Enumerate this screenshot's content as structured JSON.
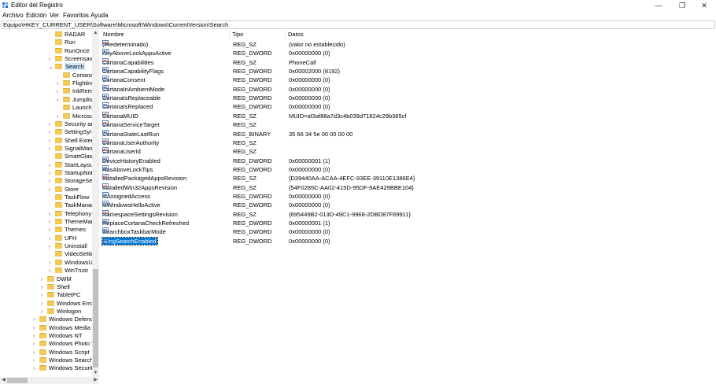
{
  "window": {
    "title": "Editor del Registro",
    "minimize": "—",
    "maximize": "❐",
    "close": "✕"
  },
  "menu": [
    "Archivo",
    "Edición",
    "Ver",
    "Favoritos",
    "Ayuda"
  ],
  "address": "Equipo\\HKEY_CURRENT_USER\\Software\\Microsoft\\Windows\\CurrentVersion\\Search",
  "tree": [
    {
      "label": "RADAR",
      "depth": 2,
      "expander": "none"
    },
    {
      "label": "Run",
      "depth": 2,
      "expander": "none"
    },
    {
      "label": "RunOnce",
      "depth": 2,
      "expander": "none"
    },
    {
      "label": "Screensaver",
      "depth": 2,
      "expander": "collapsed"
    },
    {
      "label": "Search",
      "depth": 2,
      "expander": "expanded",
      "selected": true
    },
    {
      "label": "CortanaA",
      "depth": 3,
      "expander": "none"
    },
    {
      "label": "Flighting",
      "depth": 3,
      "expander": "collapsed"
    },
    {
      "label": "InkRemin",
      "depth": 3,
      "expander": "collapsed"
    },
    {
      "label": "JumplistI",
      "depth": 3,
      "expander": "collapsed"
    },
    {
      "label": "Launch",
      "depth": 3,
      "expander": "none"
    },
    {
      "label": "Microsof",
      "depth": 3,
      "expander": "collapsed"
    },
    {
      "label": "Security and",
      "depth": 2,
      "expander": "collapsed"
    },
    {
      "label": "SettingSync",
      "depth": 2,
      "expander": "collapsed"
    },
    {
      "label": "Shell Extens",
      "depth": 2,
      "expander": "collapsed"
    },
    {
      "label": "SignalMana",
      "depth": 2,
      "expander": "collapsed"
    },
    {
      "label": "SmartGlass",
      "depth": 2,
      "expander": "none"
    },
    {
      "label": "StartLayout",
      "depth": 2,
      "expander": "collapsed"
    },
    {
      "label": "StartupNoti",
      "depth": 2,
      "expander": "collapsed"
    },
    {
      "label": "StorageSen",
      "depth": 2,
      "expander": "collapsed"
    },
    {
      "label": "Store",
      "depth": 2,
      "expander": "collapsed"
    },
    {
      "label": "TaskFlow",
      "depth": 2,
      "expander": "none"
    },
    {
      "label": "TaskManage",
      "depth": 2,
      "expander": "none"
    },
    {
      "label": "Telephony",
      "depth": 2,
      "expander": "collapsed"
    },
    {
      "label": "ThemeMana",
      "depth": 2,
      "expander": "collapsed"
    },
    {
      "label": "Themes",
      "depth": 2,
      "expander": "collapsed"
    },
    {
      "label": "UFH",
      "depth": 2,
      "expander": "collapsed"
    },
    {
      "label": "Uninstall",
      "depth": 2,
      "expander": "collapsed"
    },
    {
      "label": "VideoSettin",
      "depth": 2,
      "expander": "none"
    },
    {
      "label": "WindowsUp",
      "depth": 2,
      "expander": "collapsed"
    },
    {
      "label": "WinTrust",
      "depth": 2,
      "expander": "collapsed"
    },
    {
      "label": "DWM",
      "depth": 1,
      "expander": "collapsed"
    },
    {
      "label": "Shell",
      "depth": 1,
      "expander": "collapsed"
    },
    {
      "label": "TabletPC",
      "depth": 1,
      "expander": "collapsed"
    },
    {
      "label": "Windows Error",
      "depth": 1,
      "expander": "collapsed"
    },
    {
      "label": "Winlogon",
      "depth": 1,
      "expander": "collapsed"
    },
    {
      "label": "Windows Defende",
      "depth": 0,
      "expander": "collapsed"
    },
    {
      "label": "Windows Media",
      "depth": 0,
      "expander": "collapsed"
    },
    {
      "label": "Windows NT",
      "depth": 0,
      "expander": "collapsed"
    },
    {
      "label": "Windows Photo V",
      "depth": 0,
      "expander": "collapsed"
    },
    {
      "label": "Windows Script",
      "depth": 0,
      "expander": "collapsed"
    },
    {
      "label": "Windows Search",
      "depth": 0,
      "expander": "collapsed"
    },
    {
      "label": "Windows Security",
      "depth": 0,
      "expander": "collapsed"
    }
  ],
  "columns": {
    "name": "Nombre",
    "type": "Tipo",
    "data": "Datos"
  },
  "values": [
    {
      "name": "(Predeterminado)",
      "type": "REG_SZ",
      "data": "(valor no establecido)",
      "kind": "sz"
    },
    {
      "name": "AnyAboveLockAppsActive",
      "type": "REG_DWORD",
      "data": "0x00000000 (0)",
      "kind": "bin"
    },
    {
      "name": "CortanaCapabilities",
      "type": "REG_SZ",
      "data": "PhoneCall",
      "kind": "sz"
    },
    {
      "name": "CortanaCapabilityFlags",
      "type": "REG_DWORD",
      "data": "0x00002000 (8192)",
      "kind": "bin"
    },
    {
      "name": "CortanaConsent",
      "type": "REG_DWORD",
      "data": "0x00000000 (0)",
      "kind": "bin"
    },
    {
      "name": "CortanaInAmbientMode",
      "type": "REG_DWORD",
      "data": "0x00000000 (0)",
      "kind": "bin"
    },
    {
      "name": "CortanaIsReplaceable",
      "type": "REG_DWORD",
      "data": "0x00000000 (0)",
      "kind": "bin"
    },
    {
      "name": "CortanaIsReplaced",
      "type": "REG_DWORD",
      "data": "0x00000000 (0)",
      "kind": "bin"
    },
    {
      "name": "CortanaMUID",
      "type": "REG_SZ",
      "data": "MUID=af3af88a7d3c4b039d71824c29b365cf",
      "kind": "sz"
    },
    {
      "name": "CortanaServiceTarget",
      "type": "REG_SZ",
      "data": "",
      "kind": "sz"
    },
    {
      "name": "CortanaStateLastRun",
      "type": "REG_BINARY",
      "data": "35 66 34 5e 00 00 00 00",
      "kind": "bin"
    },
    {
      "name": "CortanaUserAuthority",
      "type": "REG_SZ",
      "data": "",
      "kind": "sz"
    },
    {
      "name": "CortanaUserId",
      "type": "REG_SZ",
      "data": "",
      "kind": "sz"
    },
    {
      "name": "DeviceHistoryEnabled",
      "type": "REG_DWORD",
      "data": "0x00000001 (1)",
      "kind": "bin"
    },
    {
      "name": "HasAboveLockTips",
      "type": "REG_DWORD",
      "data": "0x00000000 (0)",
      "kind": "bin"
    },
    {
      "name": "InstalledPackagedAppsRevision",
      "type": "REG_SZ",
      "data": "{D39440AA-ACAA-4EFC-93EE-39110E1386E4}",
      "kind": "sz"
    },
    {
      "name": "InstalledWin32AppsRevision",
      "type": "REG_SZ",
      "data": "{54F0285C-AA02-415D-95DF-9AE429BBE104}",
      "kind": "sz"
    },
    {
      "name": "IsAssignedAccess",
      "type": "REG_DWORD",
      "data": "0x00000000 (0)",
      "kind": "bin"
    },
    {
      "name": "IsWindowsHelloActive",
      "type": "REG_DWORD",
      "data": "0x00000000 (0)",
      "kind": "bin"
    },
    {
      "name": "NamespaceSettingsRevision",
      "type": "REG_SZ",
      "data": "{695449B2-013D-49C1-9968-2DBD87F69911}",
      "kind": "sz"
    },
    {
      "name": "ReplaceCortanaCheckRefreshed",
      "type": "REG_DWORD",
      "data": "0x00000001 (1)",
      "kind": "bin"
    },
    {
      "name": "SearchboxTaskbarMode",
      "type": "REG_DWORD",
      "data": "0x00000000 (0)",
      "kind": "bin"
    },
    {
      "name": "BingSearchEnabled",
      "type": "REG_DWORD",
      "data": "0x00000000 (0)",
      "kind": "bin",
      "selected": true
    }
  ]
}
